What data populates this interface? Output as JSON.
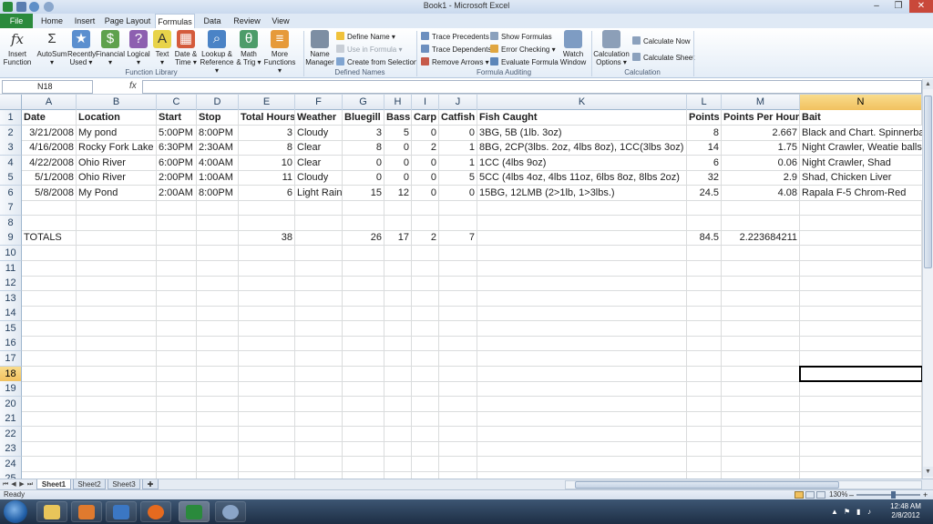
{
  "window": {
    "title": "Book1 - Microsoft Excel",
    "minimize": "–",
    "restore": "❐",
    "close": "✕"
  },
  "ribbon_tabs": [
    "File",
    "Home",
    "Insert",
    "Page Layout",
    "Formulas",
    "Data",
    "Review",
    "View"
  ],
  "active_tab": "Formulas",
  "ribbon": {
    "function_library": {
      "label": "Function Library",
      "buttons": [
        {
          "l1": "Insert",
          "l2": "Function",
          "icon": "fx"
        },
        {
          "l1": "AutoSum",
          "l2": "▾",
          "icon": "Σ"
        },
        {
          "l1": "Recently",
          "l2": "Used ▾",
          "icon": "★"
        },
        {
          "l1": "Financial",
          "l2": "▾",
          "icon": "$"
        },
        {
          "l1": "Logical",
          "l2": "▾",
          "icon": "?"
        },
        {
          "l1": "Text",
          "l2": "▾",
          "icon": "A"
        },
        {
          "l1": "Date &",
          "l2": "Time ▾",
          "icon": "▦"
        },
        {
          "l1": "Lookup &",
          "l2": "Reference ▾",
          "icon": "⌕"
        },
        {
          "l1": "Math",
          "l2": "& Trig ▾",
          "icon": "θ"
        },
        {
          "l1": "More",
          "l2": "Functions ▾",
          "icon": "≡"
        }
      ]
    },
    "defined_names": {
      "label": "Defined Names",
      "manager": {
        "l1": "Name",
        "l2": "Manager"
      },
      "define_name": "Define Name ▾",
      "use_in_formula": "Use in Formula ▾",
      "create_from_selection": "Create from Selection"
    },
    "formula_auditing": {
      "label": "Formula Auditing",
      "trace_precedents": "Trace Precedents",
      "trace_dependents": "Trace Dependents",
      "remove_arrows": "Remove Arrows ▾",
      "show_formulas": "Show Formulas",
      "error_checking": "Error Checking ▾",
      "evaluate_formula": "Evaluate Formula",
      "watch": {
        "l1": "Watch",
        "l2": "Window"
      }
    },
    "calculation": {
      "label": "Calculation",
      "options": {
        "l1": "Calculation",
        "l2": "Options ▾"
      },
      "calculate_now": "Calculate Now",
      "calculate_sheet": "Calculate Sheet"
    }
  },
  "name_box": "N18",
  "fx_label": "fx",
  "columns": [
    "A",
    "B",
    "C",
    "D",
    "E",
    "F",
    "G",
    "H",
    "I",
    "J",
    "K",
    "L",
    "M",
    "N"
  ],
  "selected_column": "N",
  "row_numbers": [
    "1",
    "2",
    "3",
    "4",
    "5",
    "6",
    "7",
    "8",
    "9",
    "10",
    "11",
    "12",
    "13",
    "14",
    "15",
    "16",
    "17",
    "18",
    "19",
    "20",
    "21",
    "22",
    "23",
    "24",
    "25"
  ],
  "selected_row": "18",
  "sheet": {
    "headers": [
      "Date",
      "Location",
      "Start",
      "Stop",
      "Total Hours",
      "Weather",
      "Bluegill",
      "Bass",
      "Carp",
      "Catfish",
      "Fish Caught",
      "Points",
      "Points Per Hour",
      "Bait"
    ],
    "rows": [
      [
        "3/21/2008",
        "My pond",
        "5:00PM",
        "8:00PM",
        "3",
        "Cloudy",
        "3",
        "5",
        "0",
        "0",
        "3BG, 5B (1lb. 3oz)",
        "8",
        "2.667",
        "Black and Chart. Spinnerbait"
      ],
      [
        "4/16/2008",
        "Rocky Fork Lake",
        "6:30PM",
        "2:30AM",
        "8",
        "Clear",
        "8",
        "0",
        "2",
        "1",
        "8BG, 2CP(3lbs. 2oz, 4lbs 8oz), 1CC(3lbs 3oz)",
        "14",
        "1.75",
        "Night Crawler, Weatie balls"
      ],
      [
        "4/22/2008",
        "Ohio River",
        "6:00PM",
        "4:00AM",
        "10",
        "Clear",
        "0",
        "0",
        "0",
        "1",
        "1CC (4lbs 9oz)",
        "6",
        "0.06",
        "Night Crawler, Shad"
      ],
      [
        "5/1/2008",
        "Ohio River",
        "2:00PM",
        "1:00AM",
        "11",
        "Cloudy",
        "0",
        "0",
        "0",
        "5",
        "5CC (4lbs 4oz, 4lbs 11oz, 6lbs 8oz, 8lbs 2oz)",
        "32",
        "2.9",
        "Shad, Chicken Liver"
      ],
      [
        "5/8/2008",
        "My Pond",
        "2:00AM",
        "8:00PM",
        "6",
        "Light Rain",
        "15",
        "12",
        "0",
        "0",
        "15BG, 12LMB (2>1lb, 1>3lbs.)",
        "24.5",
        "4.08",
        "Rapala F-5 Chrom-Red"
      ]
    ],
    "totals": {
      "label": "TOTALS",
      "total_hours": "38",
      "bluegill": "26",
      "bass": "17",
      "carp": "2",
      "catfish": "7",
      "points": "84.5",
      "points_per_hour": "2.223684211"
    }
  },
  "sheet_tabs": [
    "Sheet1",
    "Sheet2",
    "Sheet3"
  ],
  "active_sheet": "Sheet1",
  "status": {
    "ready": "Ready",
    "zoom": "130%",
    "zoom_minus": "–",
    "zoom_plus": "+"
  },
  "taskbar": {
    "time": "12:48 AM",
    "date": "2/8/2012"
  },
  "colors": {
    "file_tab": "#2a8a3c",
    "selection_header": "#f1c15f",
    "taskbar": "#1d2e44"
  }
}
